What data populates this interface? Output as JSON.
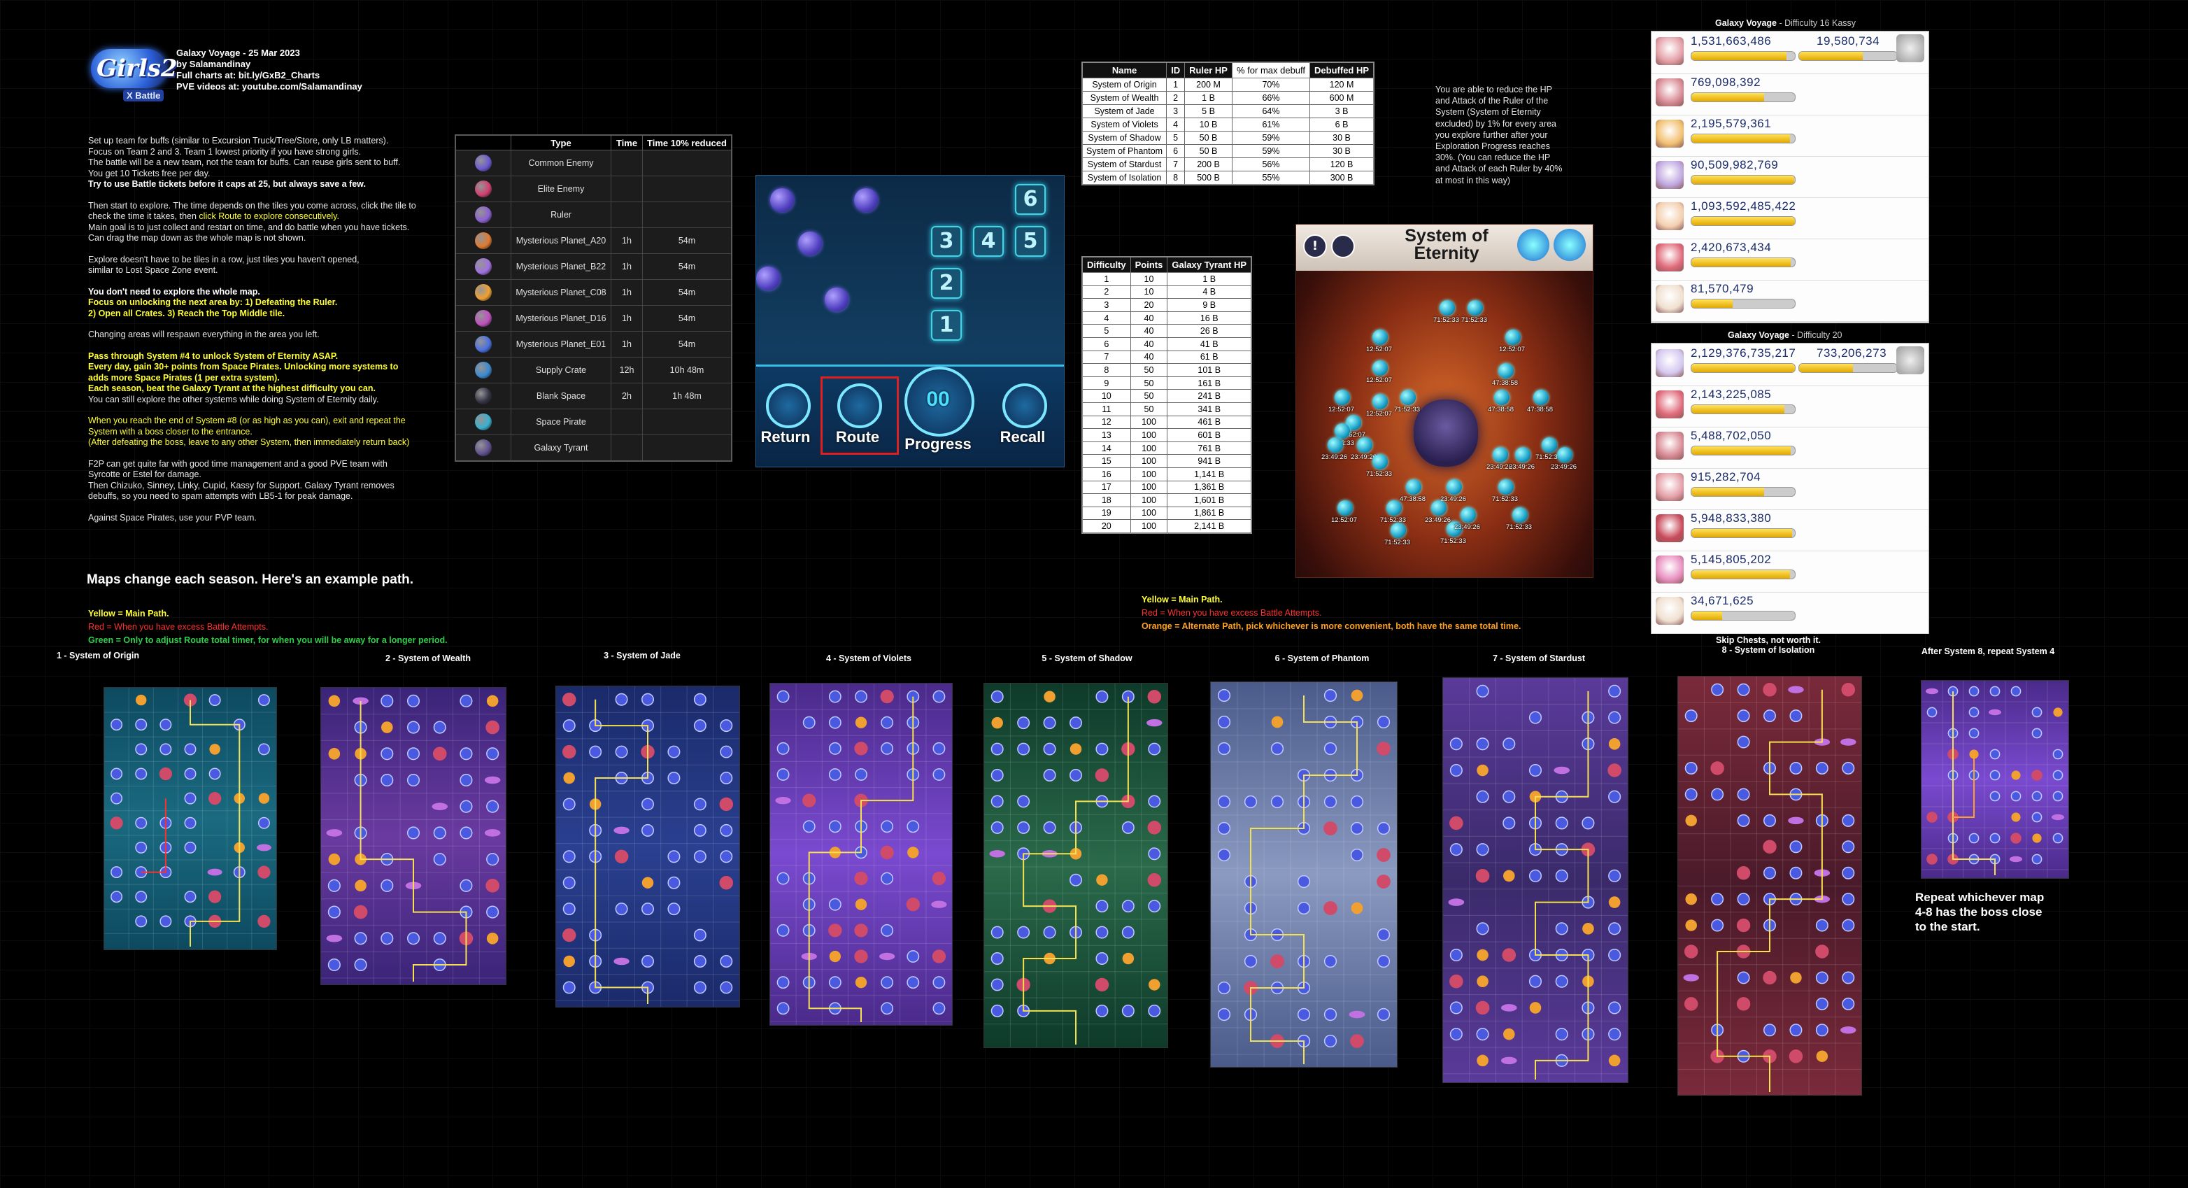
{
  "logo": {
    "main": "Girls2",
    "sub": "X Battle"
  },
  "header": {
    "lines": [
      "Galaxy Voyage - 25 Mar 2023",
      "by Salamandinay",
      "Full charts at: bit.ly/GxB2_Charts",
      "PVE videos at: youtube.com/Salamandinay"
    ]
  },
  "notes": {
    "p1": [
      "Set up team for buffs (similar to Excursion Truck/Tree/Store, only LB matters).",
      "Focus on Team 2 and 3. Team 1 lowest priority if you have strong girls.",
      "The battle will be a new team, not the team for buffs. Can reuse girls sent to buff.",
      "You get 10 Tickets free per day."
    ],
    "p1_bold": "Try to use Battle tickets before it caps at 25, but always save a few.",
    "p2_a": "Then start to explore. The time depends on the tiles you come across, click the tile to",
    "p2_b1": "check the time it takes, then ",
    "p2_b2": "click Route to explore consecutively.",
    "p2_c": [
      "Main goal is to just collect and restart on time, and do battle when you have tickets.",
      "Can drag the map down as the whole map is not shown."
    ],
    "p3": [
      "Explore doesn't have to be tiles in a row, just tiles you haven't opened,",
      "similar to Lost Space Zone event."
    ],
    "p4_bold": "You don't need to explore the whole map.",
    "p4_yellow": [
      "Focus on unlocking the next area by: 1) Defeating the Ruler.",
      "2) Open all Crates. 3) Reach the Top Middle tile."
    ],
    "p5": "Changing areas will respawn everything in the area you left.",
    "p6_yellow": [
      "Pass through System #4 to unlock System of Eternity ASAP.",
      "Every day, gain 30+ points from Space Pirates. Unlocking more systems to",
      "adds more Space Pirates (1 per extra system).",
      "Each season, beat the Galaxy Tyrant at the highest difficulty you can."
    ],
    "p6_white": "You can still explore the other systems while doing System of Eternity daily.",
    "p7_yellow": [
      "When you reach the end of System #8 (or as high as you can), exit and repeat the",
      "System with a boss closer to the entrance.",
      "(After defeating the boss, leave to any other System, then immediately return back)"
    ],
    "p8": [
      "F2P can get quite far with good time management and a good PVE team with",
      "Syrcotte or Estel for damage.",
      "Then Chizuko, Sinney, Linky, Cupid, Kassy for Support. Galaxy Tyrant removes",
      "debuffs, so you need to spam attempts with LB5-1 for peak damage."
    ],
    "p9": "Against Space Pirates, use your PVP team."
  },
  "maps_change": "Maps change each season. Here's an example path.",
  "legend1": {
    "yellow": "Yellow = Main Path.",
    "red": "Red = When you have excess Battle Attempts.",
    "green": "Green = Only to adjust Route total timer, for when you will be away for a longer period."
  },
  "legend2": {
    "yellow": "Yellow = Main Path.",
    "red": "Red = When you have excess Battle Attempts.",
    "orange": "Orange = Alternate Path, pick whichever is more convenient, both have the same total time."
  },
  "type_table": {
    "headers": [
      "Type",
      "Time",
      "Time 10% reduced"
    ],
    "rows": [
      {
        "type": "Common Enemy",
        "time": "",
        "reduced": "",
        "icon": "common-enemy",
        "color": "#6a5ad0"
      },
      {
        "type": "Elite Enemy",
        "time": "",
        "reduced": "",
        "icon": "elite-enemy",
        "color": "#d04070"
      },
      {
        "type": "Ruler",
        "time": "",
        "reduced": "",
        "icon": "ruler",
        "color": "#8a60d0"
      },
      {
        "type": "Mysterious Planet_A20",
        "time": "1h",
        "reduced": "54m",
        "icon": "planet-a20",
        "color": "#e07a30"
      },
      {
        "type": "Mysterious Planet_B22",
        "time": "1h",
        "reduced": "54m",
        "icon": "planet-b22",
        "color": "#a070e0"
      },
      {
        "type": "Mysterious Planet_C08",
        "time": "1h",
        "reduced": "54m",
        "icon": "planet-c08",
        "color": "#f0a030"
      },
      {
        "type": "Mysterious Planet_D16",
        "time": "1h",
        "reduced": "54m",
        "icon": "planet-d16",
        "color": "#c050c0"
      },
      {
        "type": "Mysterious Planet_E01",
        "time": "1h",
        "reduced": "54m",
        "icon": "planet-e01",
        "color": "#4a70e0"
      },
      {
        "type": "Supply Crate",
        "time": "12h",
        "reduced": "10h 48m",
        "icon": "supply-crate",
        "color": "#3a8ad0"
      },
      {
        "type": "Blank Space",
        "time": "2h",
        "reduced": "1h 48m",
        "icon": "blank-space",
        "color": "#333344"
      },
      {
        "type": "Space Pirate",
        "time": "",
        "reduced": "",
        "icon": "space-pirate",
        "color": "#3ab0d0"
      },
      {
        "type": "Galaxy Tyrant",
        "time": "",
        "reduced": "",
        "icon": "galaxy-tyrant",
        "color": "#605090"
      }
    ]
  },
  "ruler_table": {
    "headers": [
      "Name",
      "ID",
      "Ruler HP",
      "% for max debuff",
      "Debuffed HP"
    ],
    "rows": [
      [
        "System of Origin",
        "1",
        "200 M",
        "70%",
        "120 M"
      ],
      [
        "System of Wealth",
        "2",
        "1 B",
        "66%",
        "600 M"
      ],
      [
        "System of Jade",
        "3",
        "5 B",
        "64%",
        "3 B"
      ],
      [
        "System of Violets",
        "4",
        "10 B",
        "61%",
        "6 B"
      ],
      [
        "System of Shadow",
        "5",
        "50 B",
        "59%",
        "30 B"
      ],
      [
        "System of Phantom",
        "6",
        "50 B",
        "59%",
        "30 B"
      ],
      [
        "System of Stardust",
        "7",
        "200 B",
        "56%",
        "120 B"
      ],
      [
        "System of Isolation",
        "8",
        "500 B",
        "55%",
        "300 B"
      ]
    ]
  },
  "ruler_note": [
    "You are able to reduce the HP",
    "and Attack of the Ruler of the",
    "System (System of Eternity",
    "excluded) by 1% for every area",
    "you explore further after your",
    "Exploration Progress reaches",
    "30%. (You can reduce the HP",
    "and Attack of each Ruler by 40%",
    "at most in this way)"
  ],
  "diff_table": {
    "headers": [
      "Difficulty",
      "Points",
      "Galaxy Tyrant HP"
    ],
    "rows": [
      [
        "1",
        "10",
        "1 B"
      ],
      [
        "2",
        "10",
        "4 B"
      ],
      [
        "3",
        "20",
        "9 B"
      ],
      [
        "4",
        "40",
        "16 B"
      ],
      [
        "5",
        "40",
        "26 B"
      ],
      [
        "6",
        "40",
        "41 B"
      ],
      [
        "7",
        "40",
        "61 B"
      ],
      [
        "8",
        "50",
        "101 B"
      ],
      [
        "9",
        "50",
        "161 B"
      ],
      [
        "10",
        "50",
        "241 B"
      ],
      [
        "11",
        "50",
        "341 B"
      ],
      [
        "12",
        "100",
        "461 B"
      ],
      [
        "13",
        "100",
        "601 B"
      ],
      [
        "14",
        "100",
        "761 B"
      ],
      [
        "15",
        "100",
        "941 B"
      ],
      [
        "16",
        "100",
        "1,141 B"
      ],
      [
        "17",
        "100",
        "1,361 B"
      ],
      [
        "18",
        "100",
        "1,601 B"
      ],
      [
        "19",
        "100",
        "1,861 B"
      ],
      [
        "20",
        "100",
        "2,141 B"
      ]
    ]
  },
  "game_shot": {
    "tiles": [
      "6",
      "3",
      "4",
      "5",
      "2",
      "1"
    ],
    "buttons": {
      "return": "Return",
      "route": "Route",
      "progress": "Progress",
      "recall": "Recall",
      "timer": "00"
    }
  },
  "eternity": {
    "title_line1": "System of",
    "title_line2": "Eternity",
    "times": [
      "71:52:33",
      "71:52:33",
      "12:52:07",
      "12:52:07",
      "12:52:07",
      "47:38:58",
      "12:52:07",
      "71:52:33",
      "12:52:07",
      "47:38:58",
      "12:52:07",
      "71:52:33",
      "23:49:26",
      "23:49:26",
      "47:38:58",
      "71:52:33",
      "71:52:33",
      "71:52:33",
      "47:38:58",
      "23:49:26",
      "71:52:33",
      "12:52:07",
      "23:49:26",
      "23:49:26",
      "23:49:26",
      "71:52:33",
      "71:52:33",
      "71:52:33",
      "23:49:26",
      "23:49:26"
    ]
  },
  "diff16": {
    "title": "Galaxy Voyage",
    "sub": " - Difficulty 16 Kassy",
    "boss_value": "19,580,734",
    "boss_fill": 0.65,
    "rows": [
      {
        "value": "1,531,663,486",
        "fill": 0.92,
        "color": "#e4a0a8"
      },
      {
        "value": "769,098,392",
        "fill": 0.7,
        "color": "#d88a94"
      },
      {
        "value": "2,195,579,361",
        "fill": 0.95,
        "color": "#f2c070"
      },
      {
        "value": "90,509,982,769",
        "fill": 0.99,
        "color": "#c0a8e0"
      },
      {
        "value": "1,093,592,485,422",
        "fill": 1.0,
        "color": "#f4d0b0"
      },
      {
        "value": "2,420,673,434",
        "fill": 0.96,
        "color": "#e06a7a"
      },
      {
        "value": "81,570,479",
        "fill": 0.4,
        "color": "#f0e0d0"
      }
    ]
  },
  "diff20": {
    "title": "Galaxy Voyage",
    "sub": " - Difficulty 20",
    "boss_value": "733,206,273",
    "boss_fill": 0.55,
    "rows": [
      {
        "value": "2,129,376,735,217",
        "fill": 1.0,
        "color": "#d4c8f0"
      },
      {
        "value": "2,143,225,085",
        "fill": 0.9,
        "color": "#e06a7a"
      },
      {
        "value": "5,488,702,050",
        "fill": 0.96,
        "color": "#d88a94"
      },
      {
        "value": "915,282,704",
        "fill": 0.7,
        "color": "#e4a0a8"
      },
      {
        "value": "5,948,833,380",
        "fill": 0.97,
        "color": "#c84a5a"
      },
      {
        "value": "5,145,805,202",
        "fill": 0.95,
        "color": "#e890c0"
      },
      {
        "value": "34,671,625",
        "fill": 0.3,
        "color": "#f0e0d0"
      }
    ]
  },
  "maps": [
    {
      "caption": "1 - System of Origin",
      "theme": "teal"
    },
    {
      "caption": "2 - System of Wealth",
      "theme": "purple"
    },
    {
      "caption": "3 - System of Jade",
      "theme": "navy"
    },
    {
      "caption": "4 - System of Violets",
      "theme": "violet"
    },
    {
      "caption": "5 - System of Shadow",
      "theme": "green"
    },
    {
      "caption": "6 - System of Phantom",
      "theme": "silver"
    },
    {
      "caption": "7 - System of Stardust",
      "theme": "stardust"
    },
    {
      "caption": "Skip Chests, not worth it.|8 - System of Isolation",
      "theme": "red"
    },
    {
      "caption": "After System 8, repeat System 4",
      "theme": "violet"
    }
  ],
  "repeat_note": "Repeat whichever map 4-8 has the boss close to the start.",
  "colors": {
    "yellow": "#ffff33",
    "red": "#ff3030",
    "green": "#2ecf4a",
    "orange": "#ffa020",
    "path": "#f5e050"
  }
}
